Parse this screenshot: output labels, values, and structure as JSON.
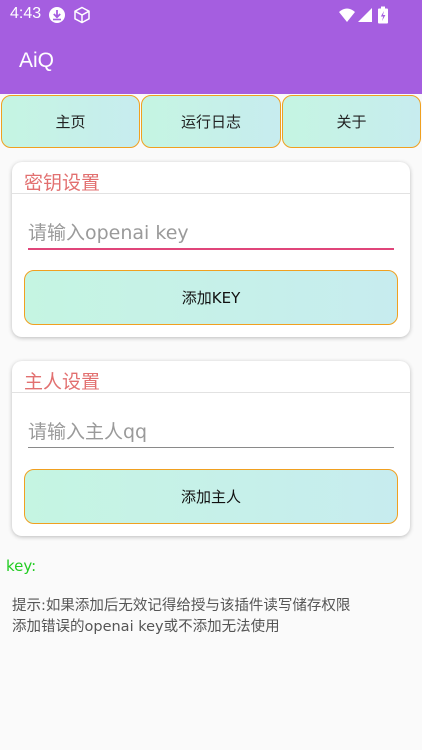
{
  "status_bar": {
    "time": "4:43",
    "icons": [
      "download-icon",
      "cube-icon",
      "wifi-icon",
      "signal-icon",
      "battery-icon"
    ]
  },
  "app": {
    "title": "AiQ"
  },
  "tabs": [
    {
      "label": "主页"
    },
    {
      "label": "运行日志"
    },
    {
      "label": "关于"
    }
  ],
  "key_card": {
    "title": "密钥设置",
    "input_placeholder": "请输入openai key",
    "input_value": "",
    "button_label": "添加KEY"
  },
  "owner_card": {
    "title": "主人设置",
    "input_placeholder": "请输入主人qq",
    "input_value": "",
    "button_label": "添加主人"
  },
  "key_status": "key:",
  "hint": {
    "line1": "提示:如果添加后无效记得给授与该插件读写储存权限",
    "line2": "添加错误的openai key或不添加无法使用"
  },
  "colors": {
    "app_bar": "#a55ee0",
    "button_border": "#f0a020",
    "button_gradient_start": "#c5f5e2",
    "button_gradient_end": "#c7ecef",
    "card_title": "#e27070",
    "key_status": "#22cc22",
    "focused_underline": "#e0457a"
  }
}
